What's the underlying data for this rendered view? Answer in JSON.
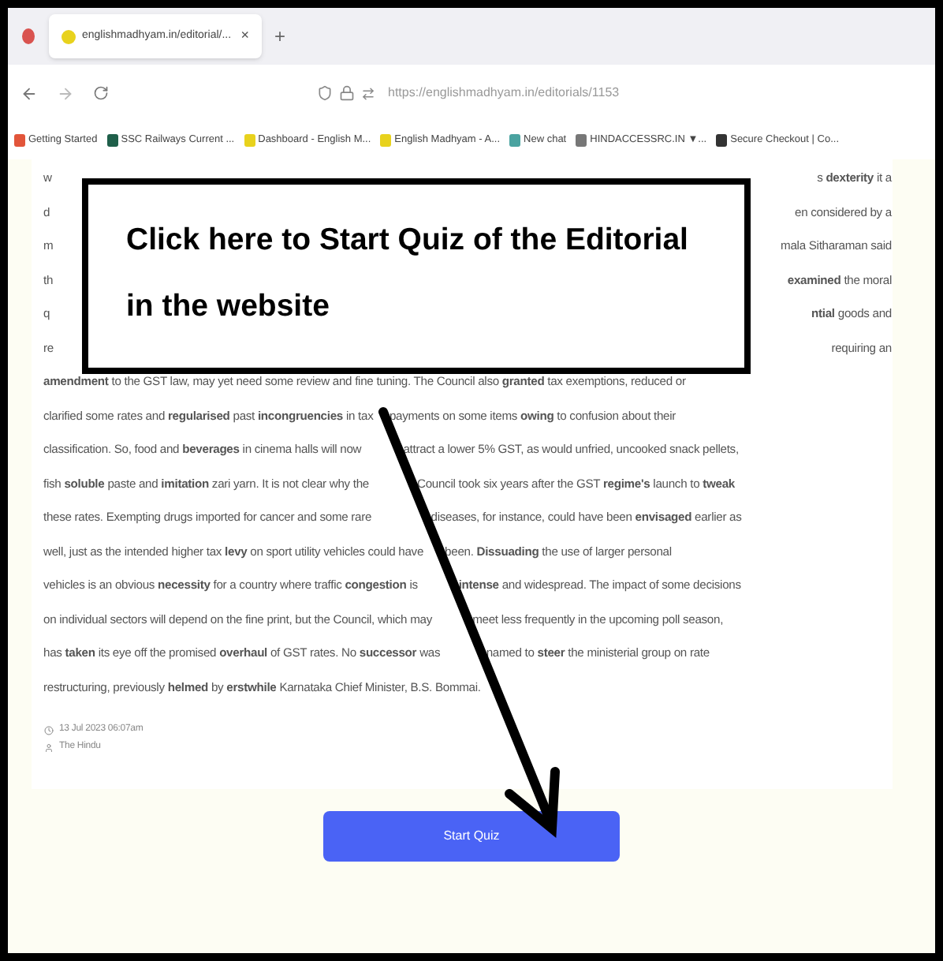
{
  "browser": {
    "tab": {
      "title": "englishmadhyam.in/editorial/...",
      "close": "×"
    },
    "new_tab": "+",
    "url": "https://englishmadhyam.in/editorials/1153",
    "bookmarks": [
      {
        "label": "Getting Started",
        "color": "#e2553a"
      },
      {
        "label": "SSC Railways Current ...",
        "color": "#1f5f4a"
      },
      {
        "label": "Dashboard - English M...",
        "color": "#e8d21d"
      },
      {
        "label": "English Madhyam - A...",
        "color": "#e8d21d"
      },
      {
        "label": "New chat",
        "color": "#4aa3a0"
      },
      {
        "label": "HINDACCESSRC.IN ▼...",
        "color": "#777777"
      },
      {
        "label": "Secure Checkout | Co...",
        "color": "#333333"
      }
    ]
  },
  "article": {
    "lines": [
      {
        "kind": "split",
        "left": "w",
        "right": "s **dexterity** it a"
      },
      {
        "kind": "split",
        "left": "d",
        "right": "en considered by a"
      },
      {
        "kind": "split",
        "left": "m",
        "right": "mala Sitharaman said"
      },
      {
        "kind": "split",
        "left": "th",
        "right": "**examined** the moral"
      },
      {
        "kind": "split",
        "left": "q",
        "right": "**ntial** goods and"
      },
      {
        "kind": "split",
        "left": "re",
        "right": "requiring an"
      },
      {
        "kind": "full",
        "text": "**amendment** to the GST law, may yet need some review and fine tuning. The Council also **granted** tax exemptions, reduced or"
      },
      {
        "kind": "broken",
        "left": "clarified some rates and **regularised** past **incongruencies** in tax",
        "right": "payments on some items **owing** to confusion about their"
      },
      {
        "kind": "broken",
        "left": "classification. So, food and **beverages** in cinema halls will now",
        "right": "attract a lower 5% GST, as would unfried, uncooked snack pellets,"
      },
      {
        "kind": "broken",
        "left": "fish **soluble** paste and **imitation** zari yarn. It is not clear why the",
        "right": "Council took six years after the GST **regime's** launch to **tweak**"
      },
      {
        "kind": "broken",
        "left": "these rates. Exempting drugs imported for cancer and some rare",
        "right": "diseases, for instance, could have been **envisaged** earlier as"
      },
      {
        "kind": "broken",
        "left": "well, just as the intended higher tax **levy** on sport utility vehicles could have",
        "right": "been. **Dissuading** the use of larger personal"
      },
      {
        "kind": "broken",
        "left": "vehicles is an obvious **necessity** for a country where traffic **congestion** is",
        "right": "**intense** and widespread. The impact of some decisions"
      },
      {
        "kind": "broken",
        "left": "on individual sectors will depend on the fine print, but the Council, which may",
        "right": "meet less frequently in the upcoming poll season,"
      },
      {
        "kind": "broken",
        "left": "has **taken** its eye off the promised **overhaul** of GST rates. No **successor** was",
        "right": "named to **steer** the ministerial group on rate"
      },
      {
        "kind": "full",
        "text": "restructuring, previously **helmed** by **erstwhile** Karnataka Chief Minister, B.S. Bommai."
      }
    ],
    "date": "13 Jul 2023 06:07am",
    "source": "The Hindu"
  },
  "start_button": "Start Quiz",
  "callout": "Click here to Start Quiz of the Editorial in the website"
}
